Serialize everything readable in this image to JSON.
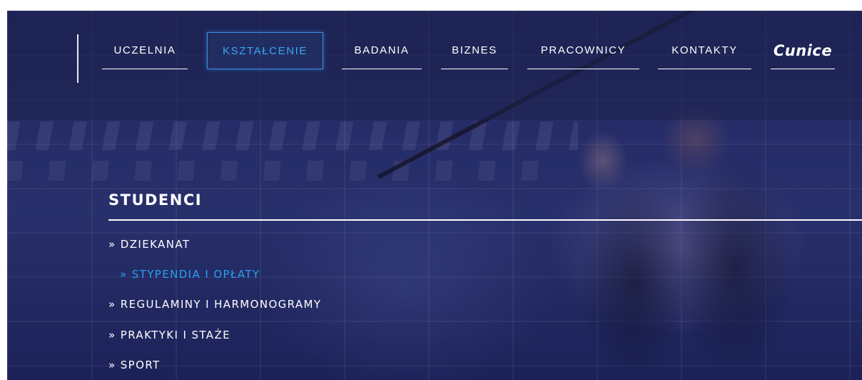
{
  "nav": {
    "items": [
      {
        "label": "UCZELNIA",
        "active": false
      },
      {
        "label": "KSZTAŁCENIE",
        "active": true
      },
      {
        "label": "BADANIA",
        "active": false
      },
      {
        "label": "BIZNES",
        "active": false
      },
      {
        "label": "PRACOWNICY",
        "active": false
      },
      {
        "label": "KONTAKTY",
        "active": false
      }
    ],
    "logo": "Cunice"
  },
  "section": {
    "title": "STUDENCI",
    "items": [
      {
        "label": "» DZIEKANAT",
        "active": false
      },
      {
        "label": "» STYPENDIA I OPŁATY",
        "active": true
      },
      {
        "label": "» REGULAMINY I HARMONOGRAMY",
        "active": false
      },
      {
        "label": "» PRAKTYKI I STAŻE",
        "active": false
      },
      {
        "label": "» SPORT",
        "active": false
      }
    ]
  },
  "colors": {
    "background": "#252c68",
    "active_accent": "#2aa0f0",
    "text": "#ffffff"
  }
}
